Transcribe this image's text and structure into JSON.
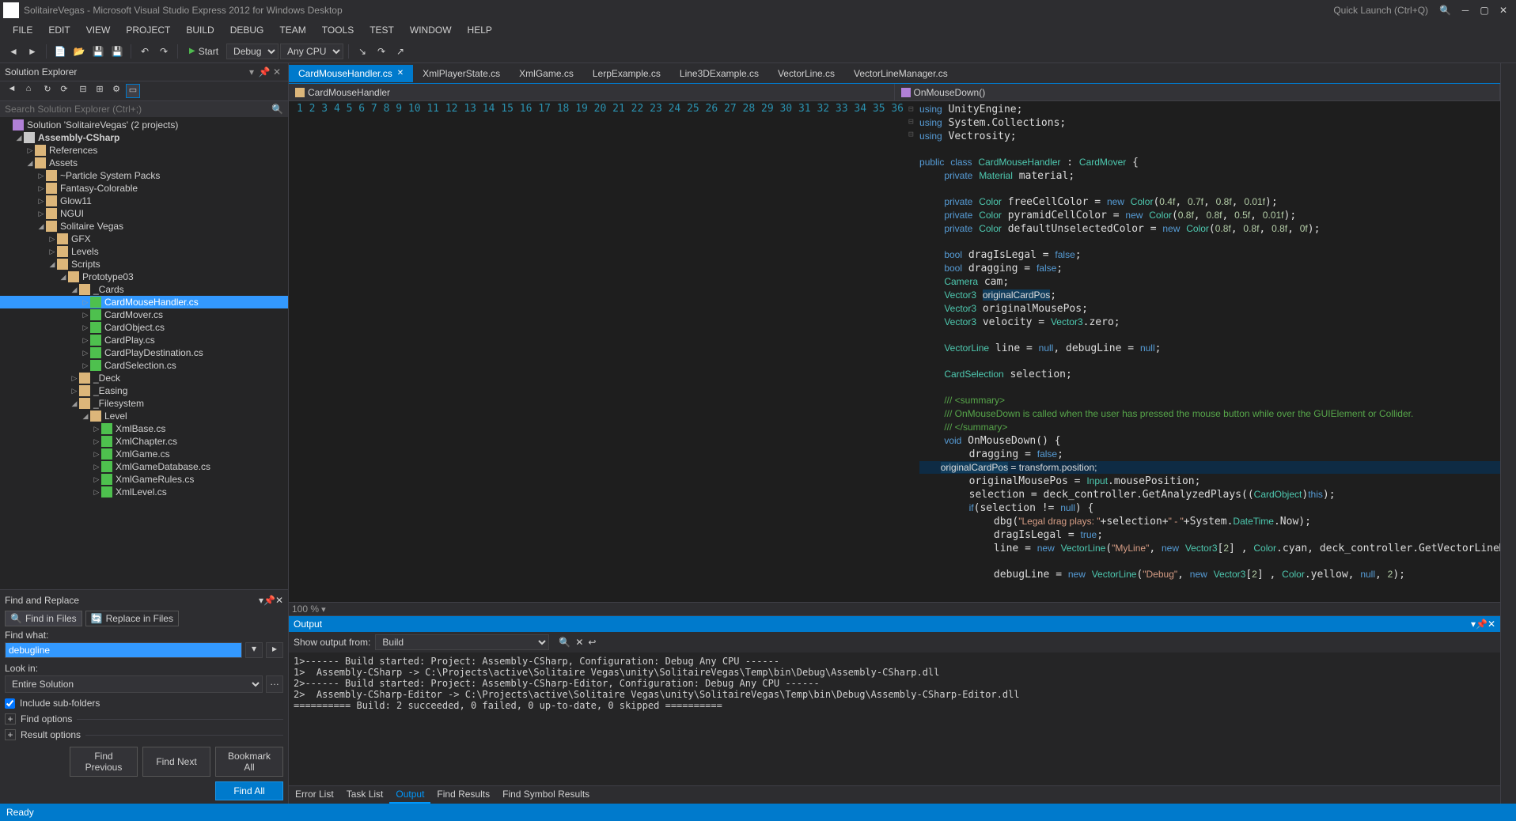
{
  "titlebar": {
    "title": "SolitaireVegas - Microsoft Visual Studio Express 2012 for Windows Desktop",
    "quick_launch": "Quick Launch (Ctrl+Q)"
  },
  "menubar": [
    "FILE",
    "EDIT",
    "VIEW",
    "PROJECT",
    "BUILD",
    "DEBUG",
    "TEAM",
    "TOOLS",
    "TEST",
    "WINDOW",
    "HELP"
  ],
  "toolbar": {
    "start": "Start",
    "config": "Debug",
    "platform": "Any CPU"
  },
  "solution_explorer": {
    "title": "Solution Explorer",
    "search_placeholder": "Search Solution Explorer (Ctrl+;)",
    "tree": [
      {
        "depth": 0,
        "arrow": "",
        "icon": "sln",
        "label": "Solution 'SolitaireVegas' (2 projects)"
      },
      {
        "depth": 1,
        "arrow": "▢",
        "icon": "proj",
        "label": "Assembly-CSharp",
        "bold": true
      },
      {
        "depth": 2,
        "arrow": "▷",
        "icon": "folder",
        "label": "References"
      },
      {
        "depth": 2,
        "arrow": "▢",
        "icon": "folder",
        "label": "Assets"
      },
      {
        "depth": 3,
        "arrow": "▷",
        "icon": "folder",
        "label": "~Particle System Packs"
      },
      {
        "depth": 3,
        "arrow": "▷",
        "icon": "folder",
        "label": "Fantasy-Colorable"
      },
      {
        "depth": 3,
        "arrow": "▷",
        "icon": "folder",
        "label": "Glow11"
      },
      {
        "depth": 3,
        "arrow": "▷",
        "icon": "folder",
        "label": "NGUI"
      },
      {
        "depth": 3,
        "arrow": "▢",
        "icon": "folder",
        "label": "Solitaire Vegas"
      },
      {
        "depth": 4,
        "arrow": "▷",
        "icon": "folder",
        "label": "GFX"
      },
      {
        "depth": 4,
        "arrow": "▷",
        "icon": "folder",
        "label": "Levels"
      },
      {
        "depth": 4,
        "arrow": "▢",
        "icon": "folder",
        "label": "Scripts"
      },
      {
        "depth": 5,
        "arrow": "▢",
        "icon": "folder",
        "label": "Prototype03"
      },
      {
        "depth": 6,
        "arrow": "▢",
        "icon": "folder",
        "label": "_Cards"
      },
      {
        "depth": 7,
        "arrow": "▷",
        "icon": "cs",
        "label": "CardMouseHandler.cs",
        "selected": true
      },
      {
        "depth": 7,
        "arrow": "▷",
        "icon": "cs",
        "label": "CardMover.cs"
      },
      {
        "depth": 7,
        "arrow": "▷",
        "icon": "cs",
        "label": "CardObject.cs"
      },
      {
        "depth": 7,
        "arrow": "▷",
        "icon": "cs",
        "label": "CardPlay.cs"
      },
      {
        "depth": 7,
        "arrow": "▷",
        "icon": "cs",
        "label": "CardPlayDestination.cs"
      },
      {
        "depth": 7,
        "arrow": "▷",
        "icon": "cs",
        "label": "CardSelection.cs"
      },
      {
        "depth": 6,
        "arrow": "▷",
        "icon": "folder",
        "label": "_Deck"
      },
      {
        "depth": 6,
        "arrow": "▷",
        "icon": "folder",
        "label": "_Easing"
      },
      {
        "depth": 6,
        "arrow": "▢",
        "icon": "folder",
        "label": "_Filesystem"
      },
      {
        "depth": 7,
        "arrow": "▢",
        "icon": "folder",
        "label": "Level"
      },
      {
        "depth": 8,
        "arrow": "▷",
        "icon": "cs",
        "label": "XmlBase.cs"
      },
      {
        "depth": 8,
        "arrow": "▷",
        "icon": "cs",
        "label": "XmlChapter.cs"
      },
      {
        "depth": 8,
        "arrow": "▷",
        "icon": "cs",
        "label": "XmlGame.cs"
      },
      {
        "depth": 8,
        "arrow": "▷",
        "icon": "cs",
        "label": "XmlGameDatabase.cs"
      },
      {
        "depth": 8,
        "arrow": "▷",
        "icon": "cs",
        "label": "XmlGameRules.cs"
      },
      {
        "depth": 8,
        "arrow": "▷",
        "icon": "cs",
        "label": "XmlLevel.cs"
      }
    ]
  },
  "find": {
    "title": "Find and Replace",
    "mode1": "Find in Files",
    "mode2": "Replace in Files",
    "find_what_label": "Find what:",
    "find_value": "debugline",
    "look_in_label": "Look in:",
    "look_in_value": "Entire Solution",
    "include_sub": "Include sub-folders",
    "find_options": "Find options",
    "result_options": "Result options",
    "btn_prev": "Find Previous",
    "btn_next": "Find Next",
    "btn_bookmark": "Bookmark All",
    "btn_findall": "Find All"
  },
  "tabs": [
    {
      "label": "CardMouseHandler.cs",
      "active": true
    },
    {
      "label": "XmlPlayerState.cs"
    },
    {
      "label": "XmlGame.cs"
    },
    {
      "label": "LerpExample.cs"
    },
    {
      "label": "Line3DExample.cs"
    },
    {
      "label": "VectorLine.cs"
    },
    {
      "label": "VectorLineManager.cs"
    }
  ],
  "navbar": {
    "left": "CardMouseHandler",
    "right": "OnMouseDown()"
  },
  "zoom": "100 %",
  "output": {
    "title": "Output",
    "show_from_label": "Show output from:",
    "show_from": "Build",
    "body": "1>------ Build started: Project: Assembly-CSharp, Configuration: Debug Any CPU ------\n1>  Assembly-CSharp -> C:\\Projects\\active\\Solitaire Vegas\\unity\\SolitaireVegas\\Temp\\bin\\Debug\\Assembly-CSharp.dll\n2>------ Build started: Project: Assembly-CSharp-Editor, Configuration: Debug Any CPU ------\n2>  Assembly-CSharp-Editor -> C:\\Projects\\active\\Solitaire Vegas\\unity\\SolitaireVegas\\Temp\\bin\\Debug\\Assembly-CSharp-Editor.dll\n========== Build: 2 succeeded, 0 failed, 0 up-to-date, 0 skipped =========="
  },
  "bottom_tabs": [
    "Error List",
    "Task List",
    "Output",
    "Find Results",
    "Find Symbol Results"
  ],
  "status": "Ready",
  "code_lines": [
    1,
    2,
    3,
    4,
    5,
    6,
    7,
    8,
    9,
    10,
    11,
    12,
    13,
    14,
    15,
    16,
    17,
    18,
    19,
    20,
    21,
    22,
    23,
    24,
    25,
    26,
    27,
    28,
    29,
    30,
    31,
    32,
    33,
    34,
    35,
    36
  ]
}
